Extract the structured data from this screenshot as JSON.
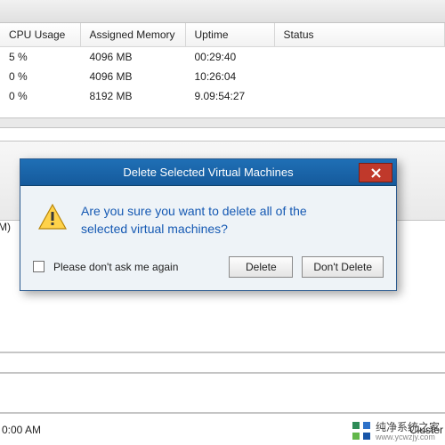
{
  "table": {
    "headers": [
      "CPU Usage",
      "Assigned Memory",
      "Uptime",
      "Status"
    ],
    "rows": [
      {
        "cpu": "5 %",
        "mem": "4096 MB",
        "uptime": "00:29:40",
        "status": ""
      },
      {
        "cpu": "0 %",
        "mem": "4096 MB",
        "uptime": "10:26:04",
        "status": ""
      },
      {
        "cpu": "0 %",
        "mem": "8192 MB",
        "uptime": "9.09:54:27",
        "status": ""
      }
    ]
  },
  "side_hint": "M)",
  "dialog": {
    "title": "Delete Selected Virtual Machines",
    "message": "Are you sure you want to delete all of the selected virtual machines?",
    "dont_ask": "Please don't ask me again",
    "delete_btn": "Delete",
    "cancel_btn": "Don't Delete"
  },
  "statusbar": {
    "time": "0:00 AM",
    "cluster": "Cluster"
  },
  "watermark": {
    "brand": "纯净系统之家",
    "url": "www.ycwzjy.com"
  },
  "colors": {
    "title_bg": "#1a66aa",
    "close_bg": "#c0392b",
    "msg_blue": "#1559b3"
  }
}
